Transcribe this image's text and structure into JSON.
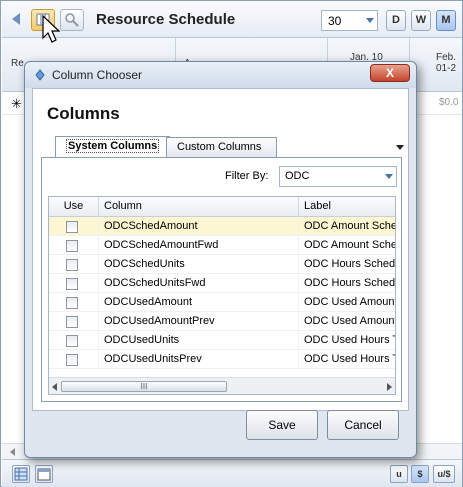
{
  "app": {
    "title": "Resource Schedule",
    "count_value": "30",
    "view_buttons": [
      "D",
      "W",
      "M"
    ],
    "active_view": "M",
    "grid_headers": [
      "Re",
      "A",
      "Jan. 10",
      "Feb.\n01-2"
    ],
    "row_value": "$0.0",
    "bottom_buttons": [
      "u",
      "$",
      "u/$"
    ]
  },
  "dialog": {
    "title": "Column Chooser",
    "close_label": "X",
    "heading": "Columns",
    "tabs": [
      "System Columns",
      "Custom Columns"
    ],
    "filter_label": "Filter By:",
    "filter_value": "ODC",
    "table": {
      "headers": [
        "Use",
        "Column",
        "Label"
      ],
      "rows": [
        {
          "column": "ODCSchedAmount",
          "label": "ODC Amount Sche",
          "checked": false
        },
        {
          "column": "ODCSchedAmountFwd",
          "label": "ODC Amount Sche",
          "checked": false
        },
        {
          "column": "ODCSchedUnits",
          "label": "ODC Hours Sched",
          "checked": false
        },
        {
          "column": "ODCSchedUnitsFwd",
          "label": "ODC Hours Sched",
          "checked": false
        },
        {
          "column": "ODCUsedAmount",
          "label": "ODC Used Amount",
          "checked": false
        },
        {
          "column": "ODCUsedAmountPrev",
          "label": "ODC Used Amount",
          "checked": false
        },
        {
          "column": "ODCUsedUnits",
          "label": "ODC Used Hours T",
          "checked": false
        },
        {
          "column": "ODCUsedUnitsPrev",
          "label": "ODC Used Hours T",
          "checked": false
        }
      ],
      "scroll_thumb": "III"
    },
    "save_label": "Save",
    "cancel_label": "Cancel"
  },
  "colors": {
    "highlight_row": "#fdf6d3",
    "accent": "#4a6ea8",
    "close_button": "#c4452b"
  }
}
